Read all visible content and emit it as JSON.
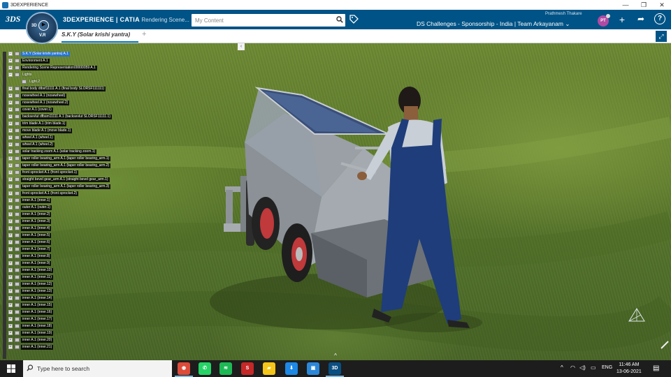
{
  "window": {
    "title": "3DEXPERIENCE",
    "controls": [
      "—",
      "❐",
      "✕"
    ]
  },
  "header": {
    "logo": "3DS",
    "compass": {
      "top_label": "3D",
      "version": "V.R"
    },
    "brand_strong": "3DEXPERIENCE | CATIA",
    "brand_app": "Rendering Scene...",
    "search": {
      "placeholder": "My Content"
    },
    "context": "DS Challenges - Sponsorship - India | Team Arkayanam",
    "context_caret": "⌄",
    "user_name": "Prathmesh Thakare",
    "avatar_initials": "PT",
    "icons": [
      "search-icon",
      "tag-icon",
      "plus-icon",
      "share-icon",
      "help-icon"
    ],
    "plus_symbol": "+",
    "share_symbol": "➦",
    "help_symbol": "?"
  },
  "tabs": [
    {
      "label": "S.K.Y (Solar krishi yantra)",
      "active": true
    }
  ],
  "tab_add_symbol": "+",
  "tree": {
    "collapse_symbol": "‹",
    "nodes": [
      {
        "label": "S.K.Y (Solar krishi yantra) A.1",
        "toggle": "−",
        "root": true
      },
      {
        "label": "Environment A.1",
        "toggle": "+"
      },
      {
        "label": "Rendering Scene Representation00000059 A.1",
        "toggle": "+"
      },
      {
        "label": "Lights",
        "toggle": "−",
        "plain": true
      },
      {
        "label": "Light.2",
        "toggle": "",
        "plain": true,
        "indent": true
      },
      {
        "label": "final body dtbsf11111 A.1 (final body SLORSF111111)",
        "toggle": "+"
      },
      {
        "label": "nosewheel A.1 (nosewheel)",
        "toggle": "+"
      },
      {
        "label": "nosewheel A.1 (nosewheel.2)",
        "toggle": "+"
      },
      {
        "label": "cover A.1 (cover.1)",
        "toggle": "+"
      },
      {
        "label": "backsevlut dfbsm11111 A.1 (backsevlut SLORSF11111.1)",
        "toggle": "+"
      },
      {
        "label": "trim blade A.1 (trim blade.1)",
        "toggle": "+"
      },
      {
        "label": "move blade A.1 (move blade.1)",
        "toggle": "+"
      },
      {
        "label": "wheel A.1 (wheel.1)",
        "toggle": "+"
      },
      {
        "label": "wheel A.1 (wheel.2)",
        "toggle": "+"
      },
      {
        "label": "solar tracking zoom A.1 (solar tracking zoom.1)",
        "toggle": "+"
      },
      {
        "label": "taper roller bearing_arm A.1 (taper roller bearing_arm.1)",
        "toggle": "+"
      },
      {
        "label": "taper roller bearing_arm A.1 (taper roller bearing_arm.2)",
        "toggle": "+"
      },
      {
        "label": "front sprocket A.1 (front sprocket.1)",
        "toggle": "+"
      },
      {
        "label": "straight bevel gear_arm A.1 (straight bevel gear_arm.1)",
        "toggle": "+"
      },
      {
        "label": "taper roller bearing_arm A.1 (taper roller bearing_arm.3)",
        "toggle": "+"
      },
      {
        "label": "front sprocket A.1 (front sprocket.2)",
        "toggle": "+"
      },
      {
        "label": "inner A.1 (inner.1)",
        "toggle": "+"
      },
      {
        "label": "outer A.1 (outer.1)",
        "toggle": "+"
      },
      {
        "label": "inner A.1 (inner.2)",
        "toggle": "+"
      },
      {
        "label": "inner A.1 (inner.3)",
        "toggle": "+"
      },
      {
        "label": "inner A.1 (inner.4)",
        "toggle": "+"
      },
      {
        "label": "inner A.1 (inner.5)",
        "toggle": "+"
      },
      {
        "label": "inner A.1 (inner.6)",
        "toggle": "+"
      },
      {
        "label": "inner A.1 (inner.7)",
        "toggle": "+"
      },
      {
        "label": "inner A.1 (inner.8)",
        "toggle": "+"
      },
      {
        "label": "inner A.1 (inner.9)",
        "toggle": "+"
      },
      {
        "label": "inner A.1 (inner.10)",
        "toggle": "+"
      },
      {
        "label": "inner A.1 (inner.11)",
        "toggle": "+"
      },
      {
        "label": "inner A.1 (inner.12)",
        "toggle": "+"
      },
      {
        "label": "inner A.1 (inner.13)",
        "toggle": "+"
      },
      {
        "label": "inner A.1 (inner.14)",
        "toggle": "+"
      },
      {
        "label": "inner A.1 (inner.15)",
        "toggle": "+"
      },
      {
        "label": "inner A.1 (inner.16)",
        "toggle": "+"
      },
      {
        "label": "inner A.1 (inner.17)",
        "toggle": "+"
      },
      {
        "label": "inner A.1 (inner.18)",
        "toggle": "+"
      },
      {
        "label": "inner A.1 (inner.19)",
        "toggle": "+"
      },
      {
        "label": "inner A.1 (inner.20)",
        "toggle": "+"
      },
      {
        "label": "inner A.1 (inner.21)",
        "toggle": "+"
      }
    ]
  },
  "taskbar": {
    "search_placeholder": "Type here to search",
    "apps": [
      {
        "name": "chrome-app",
        "glyph": "◉",
        "color": "#dd4b39"
      },
      {
        "name": "whatsapp-app",
        "glyph": "✆",
        "color": "#25d366"
      },
      {
        "name": "spotify-app",
        "glyph": "≋",
        "color": "#1db954"
      },
      {
        "name": "app-red",
        "glyph": "S",
        "color": "#c62828"
      },
      {
        "name": "sticky-notes-app",
        "glyph": "▰",
        "color": "#f5c518"
      },
      {
        "name": "app-blue",
        "glyph": "⬇",
        "color": "#1e88e5"
      },
      {
        "name": "photos-app",
        "glyph": "▣",
        "color": "#2b88d8"
      },
      {
        "name": "3dexperience-app",
        "glyph": "3D",
        "color": "#0a4f82"
      }
    ],
    "tray": {
      "chevron": "^",
      "wifi": "◠",
      "volume": "◁)",
      "battery": "▭",
      "language": "ENG"
    },
    "time": "11:46 AM",
    "date": "13-06-2021",
    "notification_symbol": "▤"
  },
  "viewport": {
    "collapse_up_symbol": "^"
  },
  "colors": {
    "header": "#005386",
    "accent": "#0079c1",
    "tree_root": "#2a74c9"
  }
}
